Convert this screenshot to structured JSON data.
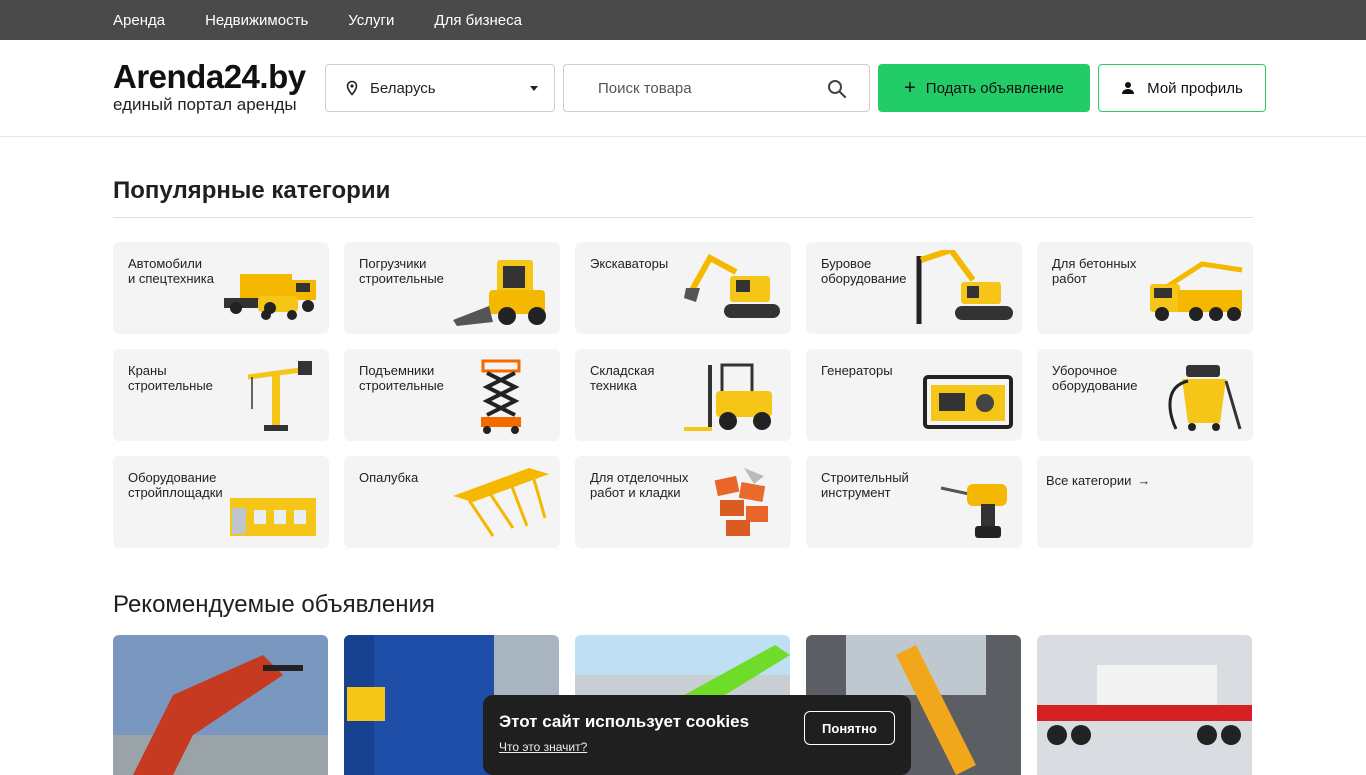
{
  "topnav": {
    "items": [
      "Аренда",
      "Недвижимость",
      "Услуги",
      "Для бизнеса"
    ]
  },
  "header": {
    "logo_title": "Arenda24.by",
    "logo_subtitle": "единый портал аренды",
    "region": "Беларусь",
    "search_placeholder": "Поиск товара",
    "post_button": "Подать объявление",
    "profile_button": "Мой профиль"
  },
  "popular": {
    "title": "Популярные категории",
    "categories": [
      {
        "label": "Автомобили\nи спецтехника",
        "icon": "truck-icon"
      },
      {
        "label": "Погрузчики\nстроительные",
        "icon": "skid-loader-icon"
      },
      {
        "label": "Экскаваторы",
        "icon": "excavator-icon"
      },
      {
        "label": "Буровое\nоборудование",
        "icon": "drill-rig-icon"
      },
      {
        "label": "Для бетонных\nработ",
        "icon": "concrete-pump-icon"
      },
      {
        "label": "Краны\nстроительные",
        "icon": "crane-icon"
      },
      {
        "label": "Подъемники\nстроительные",
        "icon": "scissor-lift-icon"
      },
      {
        "label": "Складская\nтехника",
        "icon": "forklift-icon"
      },
      {
        "label": "Генераторы",
        "icon": "generator-icon"
      },
      {
        "label": "Уборочное\nоборудование",
        "icon": "vacuum-icon"
      },
      {
        "label": "Оборудование\nстройплощадки",
        "icon": "container-cabin-icon"
      },
      {
        "label": "Опалубка",
        "icon": "formwork-icon"
      },
      {
        "label": "Для отделочных\nработ и кладки",
        "icon": "bricks-icon"
      },
      {
        "label": "Строительный\nинструмент",
        "icon": "power-drill-icon"
      }
    ],
    "all_label": "Все категории"
  },
  "recommended": {
    "title": "Рекомендуемые объявления"
  },
  "cookie": {
    "title": "Этот сайт использует cookies",
    "link": "Что это значит?",
    "button": "Понятно"
  },
  "colors": {
    "accent_green": "#22cc66",
    "topnav_bg": "#4a4a4a",
    "card_bg": "#f4f4f4",
    "equipment_yellow": "#f5c518"
  }
}
